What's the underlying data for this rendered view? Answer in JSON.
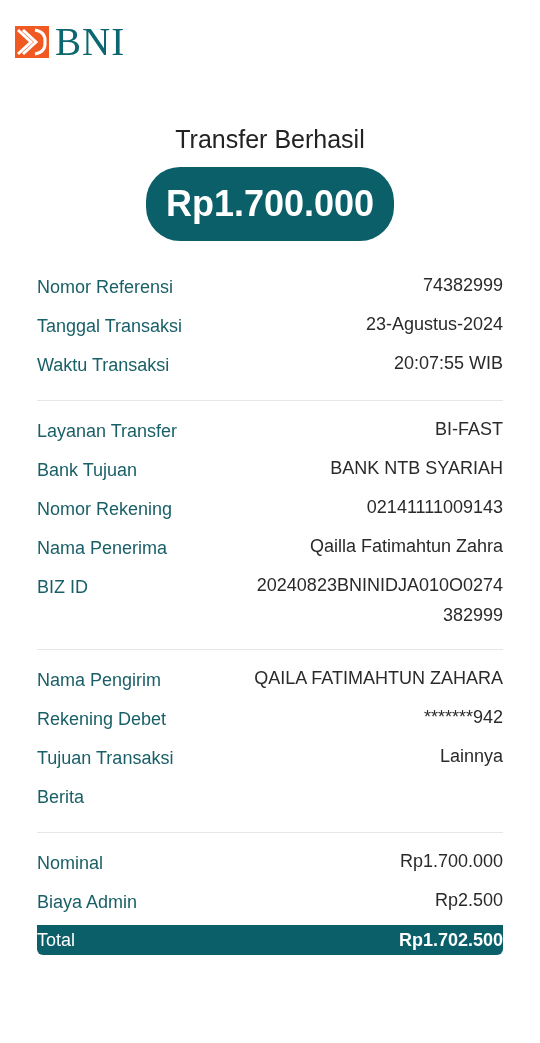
{
  "logo": {
    "text": "BNI"
  },
  "title": "Transfer Berhasil",
  "amount": "Rp1.700.000",
  "sections": [
    {
      "rows": [
        {
          "kind": "plain",
          "label": "Nomor Referensi",
          "value": "74382999"
        },
        {
          "kind": "plain",
          "label": "Tanggal Transaksi",
          "value": "23-Agustus-2024"
        },
        {
          "kind": "plain",
          "label": "Waktu Transaksi",
          "value": "20:07:55 WIB"
        }
      ]
    },
    {
      "rows": [
        {
          "kind": "plain",
          "label": "Layanan Transfer",
          "value": "BI-FAST"
        },
        {
          "kind": "plain",
          "label": "Bank Tujuan",
          "value": "BANK NTB SYARIAH"
        },
        {
          "kind": "plain",
          "label": "Nomor Rekening",
          "value": "02141111009143"
        },
        {
          "kind": "plain",
          "label": "Nama Penerima",
          "value": "Qailla Fatimahtun Zahra"
        },
        {
          "kind": "plain",
          "label": "BIZ ID",
          "value": "20240823BNINIDJA010O0274382999"
        }
      ]
    },
    {
      "rows": [
        {
          "kind": "plain",
          "label": "Nama Pengirim",
          "value": "QAILA FATIMAHTUN ZAHARA"
        },
        {
          "kind": "plain",
          "label": "Rekening Debet",
          "value": "*******942"
        },
        {
          "kind": "plain",
          "label": "Tujuan Transaksi",
          "value": "Lainnya"
        },
        {
          "kind": "plain",
          "label": "Berita"
        }
      ]
    },
    {
      "rows": [
        {
          "kind": "plain",
          "label": "Nominal",
          "value": "Rp1.700.000"
        },
        {
          "kind": "plain",
          "label": "Biaya Admin",
          "value": "Rp2.500"
        },
        {
          "kind": "total",
          "label": "Total",
          "value": "Rp1.702.500"
        }
      ]
    }
  ]
}
